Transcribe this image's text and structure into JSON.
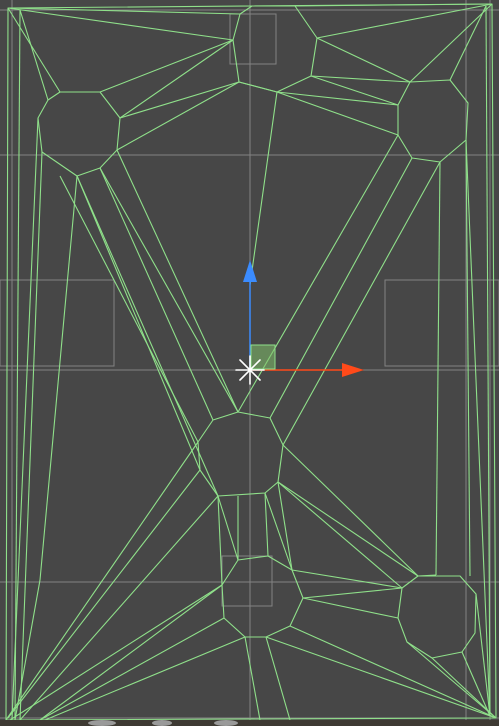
{
  "viewport": {
    "background": "#474747",
    "grid_color": "#8a8a8a",
    "wire_color": "#8fe08a",
    "y_axis_color": "#3b8cff",
    "x_axis_color": "#ff4a1a"
  },
  "gizmo": {
    "icons": [
      "move-handle-y-arrow",
      "move-handle-x-arrow",
      "pivot-icon",
      "xy-plane-handle"
    ]
  }
}
